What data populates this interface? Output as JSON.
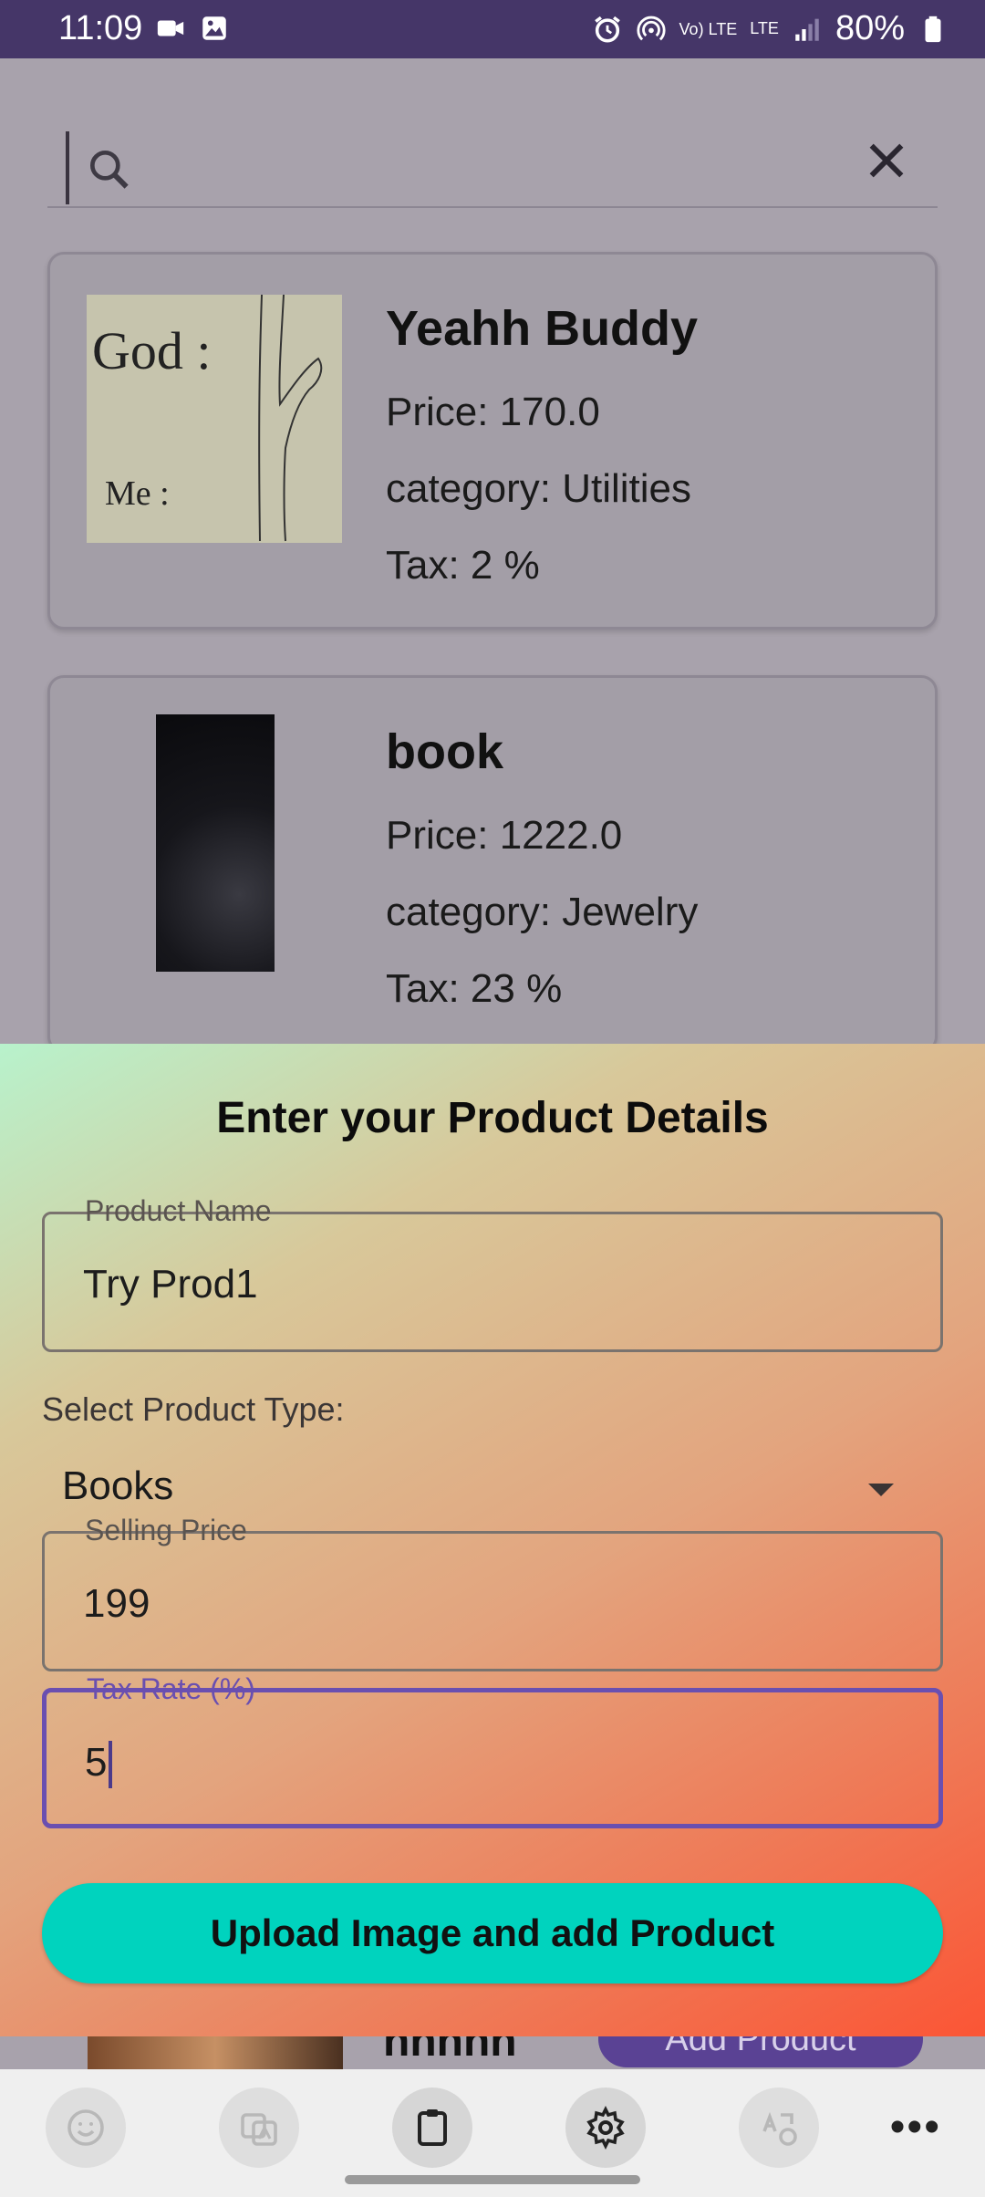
{
  "status_bar": {
    "time": "11:09",
    "battery": "80%",
    "network_label": "Vo) LTE",
    "lte_label": "LTE"
  },
  "search": {
    "placeholder": ""
  },
  "products": [
    {
      "title": "Yeahh Buddy",
      "price": "Price: 170.0",
      "category": "category: Utilities",
      "tax": "Tax: 2 %",
      "image_text_top": "God :",
      "image_text_bottom": "Me :"
    },
    {
      "title": "book",
      "price": "Price: 1222.0",
      "category": "category: Jewelry",
      "tax": "Tax: 23 %"
    }
  ],
  "sheet": {
    "title": "Enter your Product Details",
    "product_name_label": "Product Name",
    "product_name_value": "Try Prod1",
    "select_label": "Select Product Type:",
    "select_value": "Books",
    "selling_price_label": "Selling Price",
    "selling_price_value": "199",
    "tax_rate_label": "Tax Rate (%)",
    "tax_rate_value": "5",
    "upload_button": "Upload Image and add Product"
  },
  "peek": {
    "add_product_button": "Add Product",
    "partial_title": "hhhhh"
  },
  "colors": {
    "status_bar": "#453668",
    "accent": "#6a4fb0",
    "button": "#00d3be"
  }
}
